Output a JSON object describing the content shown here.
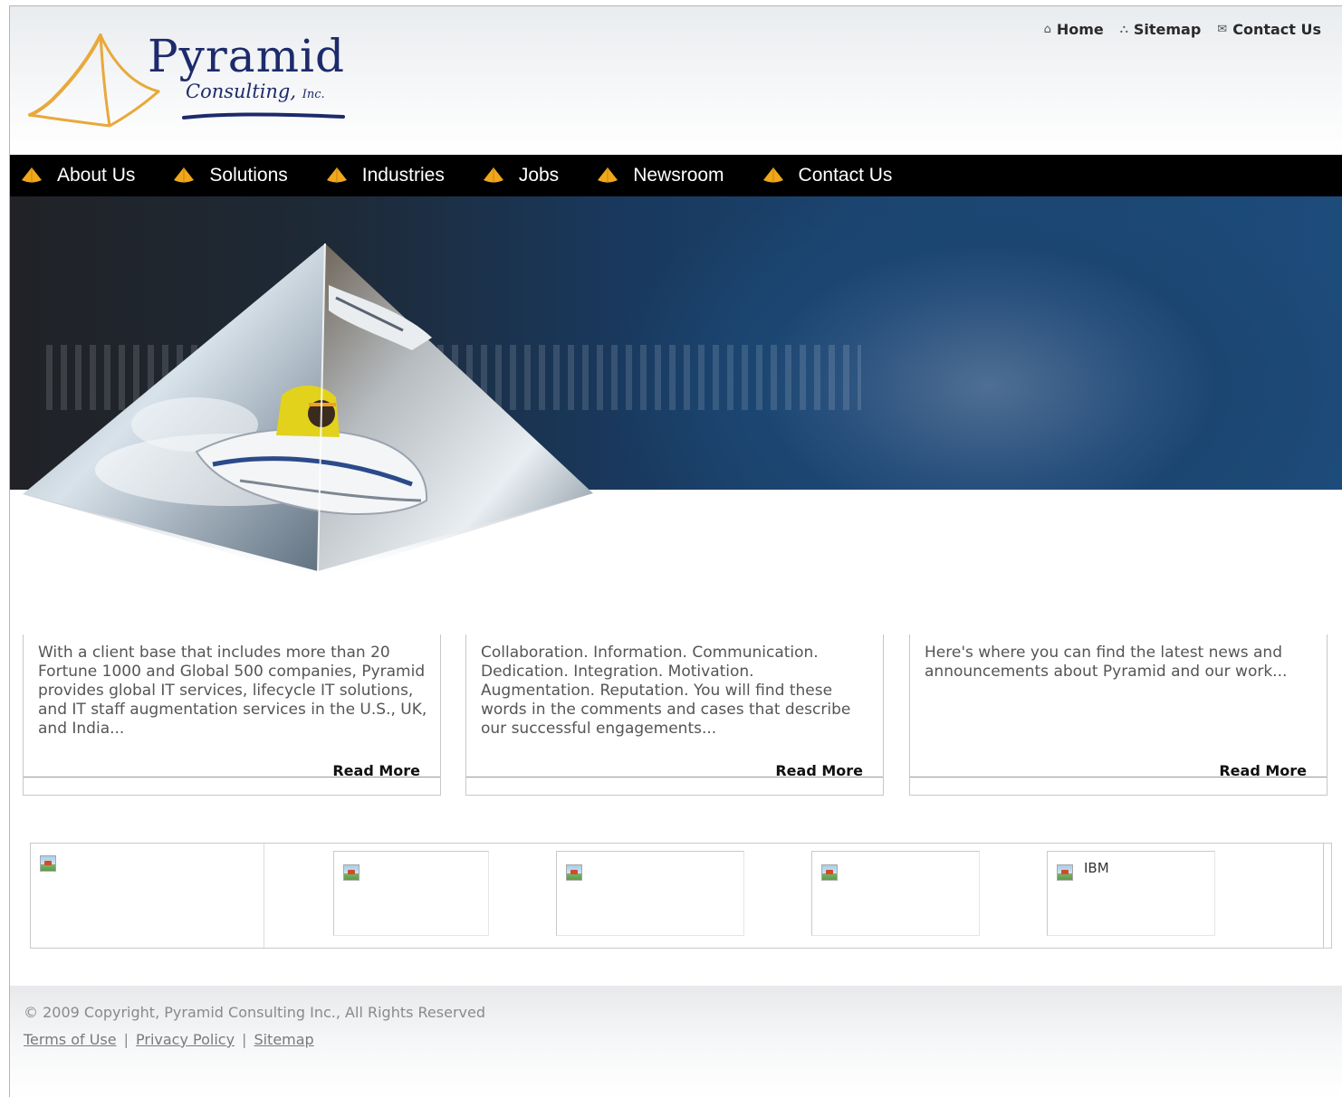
{
  "header": {
    "logo": {
      "name": "Pyramid",
      "sub": "Consulting,",
      "suffix": "Inc."
    },
    "top_links": [
      {
        "icon": "home-icon",
        "label": "Home"
      },
      {
        "icon": "sitemap-icon",
        "label": "Sitemap"
      },
      {
        "icon": "envelope-icon",
        "label": "Contact Us"
      }
    ]
  },
  "nav": {
    "items": [
      {
        "label": "About Us"
      },
      {
        "label": "Solutions"
      },
      {
        "label": "Industries"
      },
      {
        "label": "Jobs"
      },
      {
        "label": "Newsroom"
      },
      {
        "label": "Contact Us"
      }
    ],
    "bullet_color": "#f0a81a"
  },
  "info_boxes": [
    {
      "text": "With a client base that includes more than 20 Fortune 1000 and Global 500 companies, Pyramid provides global IT services, lifecycle IT solutions, and IT staff augmentation services in the U.S., UK, and India...",
      "link": "Read More"
    },
    {
      "text": "Collaboration. Information. Communication. Dedication. Integration. Motivation. Augmentation. Reputation. You will find these words in the comments and cases that describe our successful engagements...",
      "link": "Read More"
    },
    {
      "text": "Here's where you can find the latest news and announcements about Pyramid and our work...",
      "link": "Read More"
    }
  ],
  "clients": [
    {
      "alt": ""
    },
    {
      "alt": ""
    },
    {
      "alt": ""
    },
    {
      "alt": ""
    },
    {
      "alt": "IBM"
    }
  ],
  "footer": {
    "copyright": "© 2009 Copyright, Pyramid Consulting Inc., All Rights Reserved",
    "links": [
      {
        "label": "Terms of Use"
      },
      {
        "label": "Privacy Policy"
      },
      {
        "label": "Sitemap"
      }
    ],
    "separator": "|"
  }
}
